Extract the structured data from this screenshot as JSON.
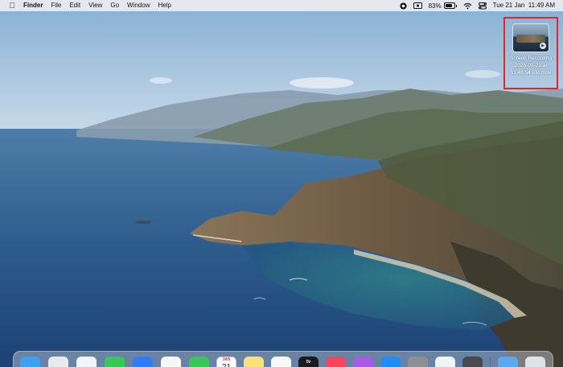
{
  "menubar": {
    "app_name": "Finder",
    "menus": [
      "File",
      "Edit",
      "View",
      "Go",
      "Window",
      "Help"
    ],
    "status": {
      "battery_percent": "83%",
      "battery_level": 0.83,
      "datetime": "Tue 21 Jan  11:49 AM",
      "icons": [
        "record-icon",
        "screen-mirror-icon",
        "wifi-icon",
        "control-center-icon"
      ]
    }
  },
  "desktop": {
    "file": {
      "name_line1": "Screen Recording",
      "name_line2": "2025-01-21 at",
      "name_line3": "11.48.54 AM.mov",
      "selection_color": "#e0262b"
    }
  },
  "dock": {
    "items": [
      {
        "name": "finder-icon",
        "color": "#3ea0f0"
      },
      {
        "name": "launchpad-icon",
        "color": "#e9e9ee"
      },
      {
        "name": "safari-icon",
        "color": "#f2f6fb"
      },
      {
        "name": "messages-icon",
        "color": "#38c858"
      },
      {
        "name": "mail-icon",
        "color": "#2f7df6"
      },
      {
        "name": "photos-icon",
        "color": "#f7f7f7"
      },
      {
        "name": "facetime-icon",
        "color": "#3ac55a"
      },
      {
        "name": "calendar-icon",
        "color": "#ffffff",
        "month": "JAN",
        "day": "21"
      },
      {
        "name": "notes-icon",
        "color": "#f8e27a"
      },
      {
        "name": "reminders-icon",
        "color": "#f8f8f8"
      },
      {
        "name": "tv-icon",
        "color": "#1b1b1d",
        "label": "tv"
      },
      {
        "name": "music-icon",
        "color": "#f5445e"
      },
      {
        "name": "podcasts-icon",
        "color": "#a65ae6"
      },
      {
        "name": "app-store-icon",
        "color": "#1e8df5"
      },
      {
        "name": "system-settings-icon",
        "color": "#8e8e93"
      },
      {
        "name": "chrome-icon",
        "color": "#f1f3f4"
      },
      {
        "name": "quicktime-icon",
        "color": "#4a4a4e"
      },
      {
        "name": "downloads-folder-icon",
        "color": "#5aa9f0"
      },
      {
        "name": "trash-icon",
        "color": "#dfe3e8"
      }
    ]
  }
}
